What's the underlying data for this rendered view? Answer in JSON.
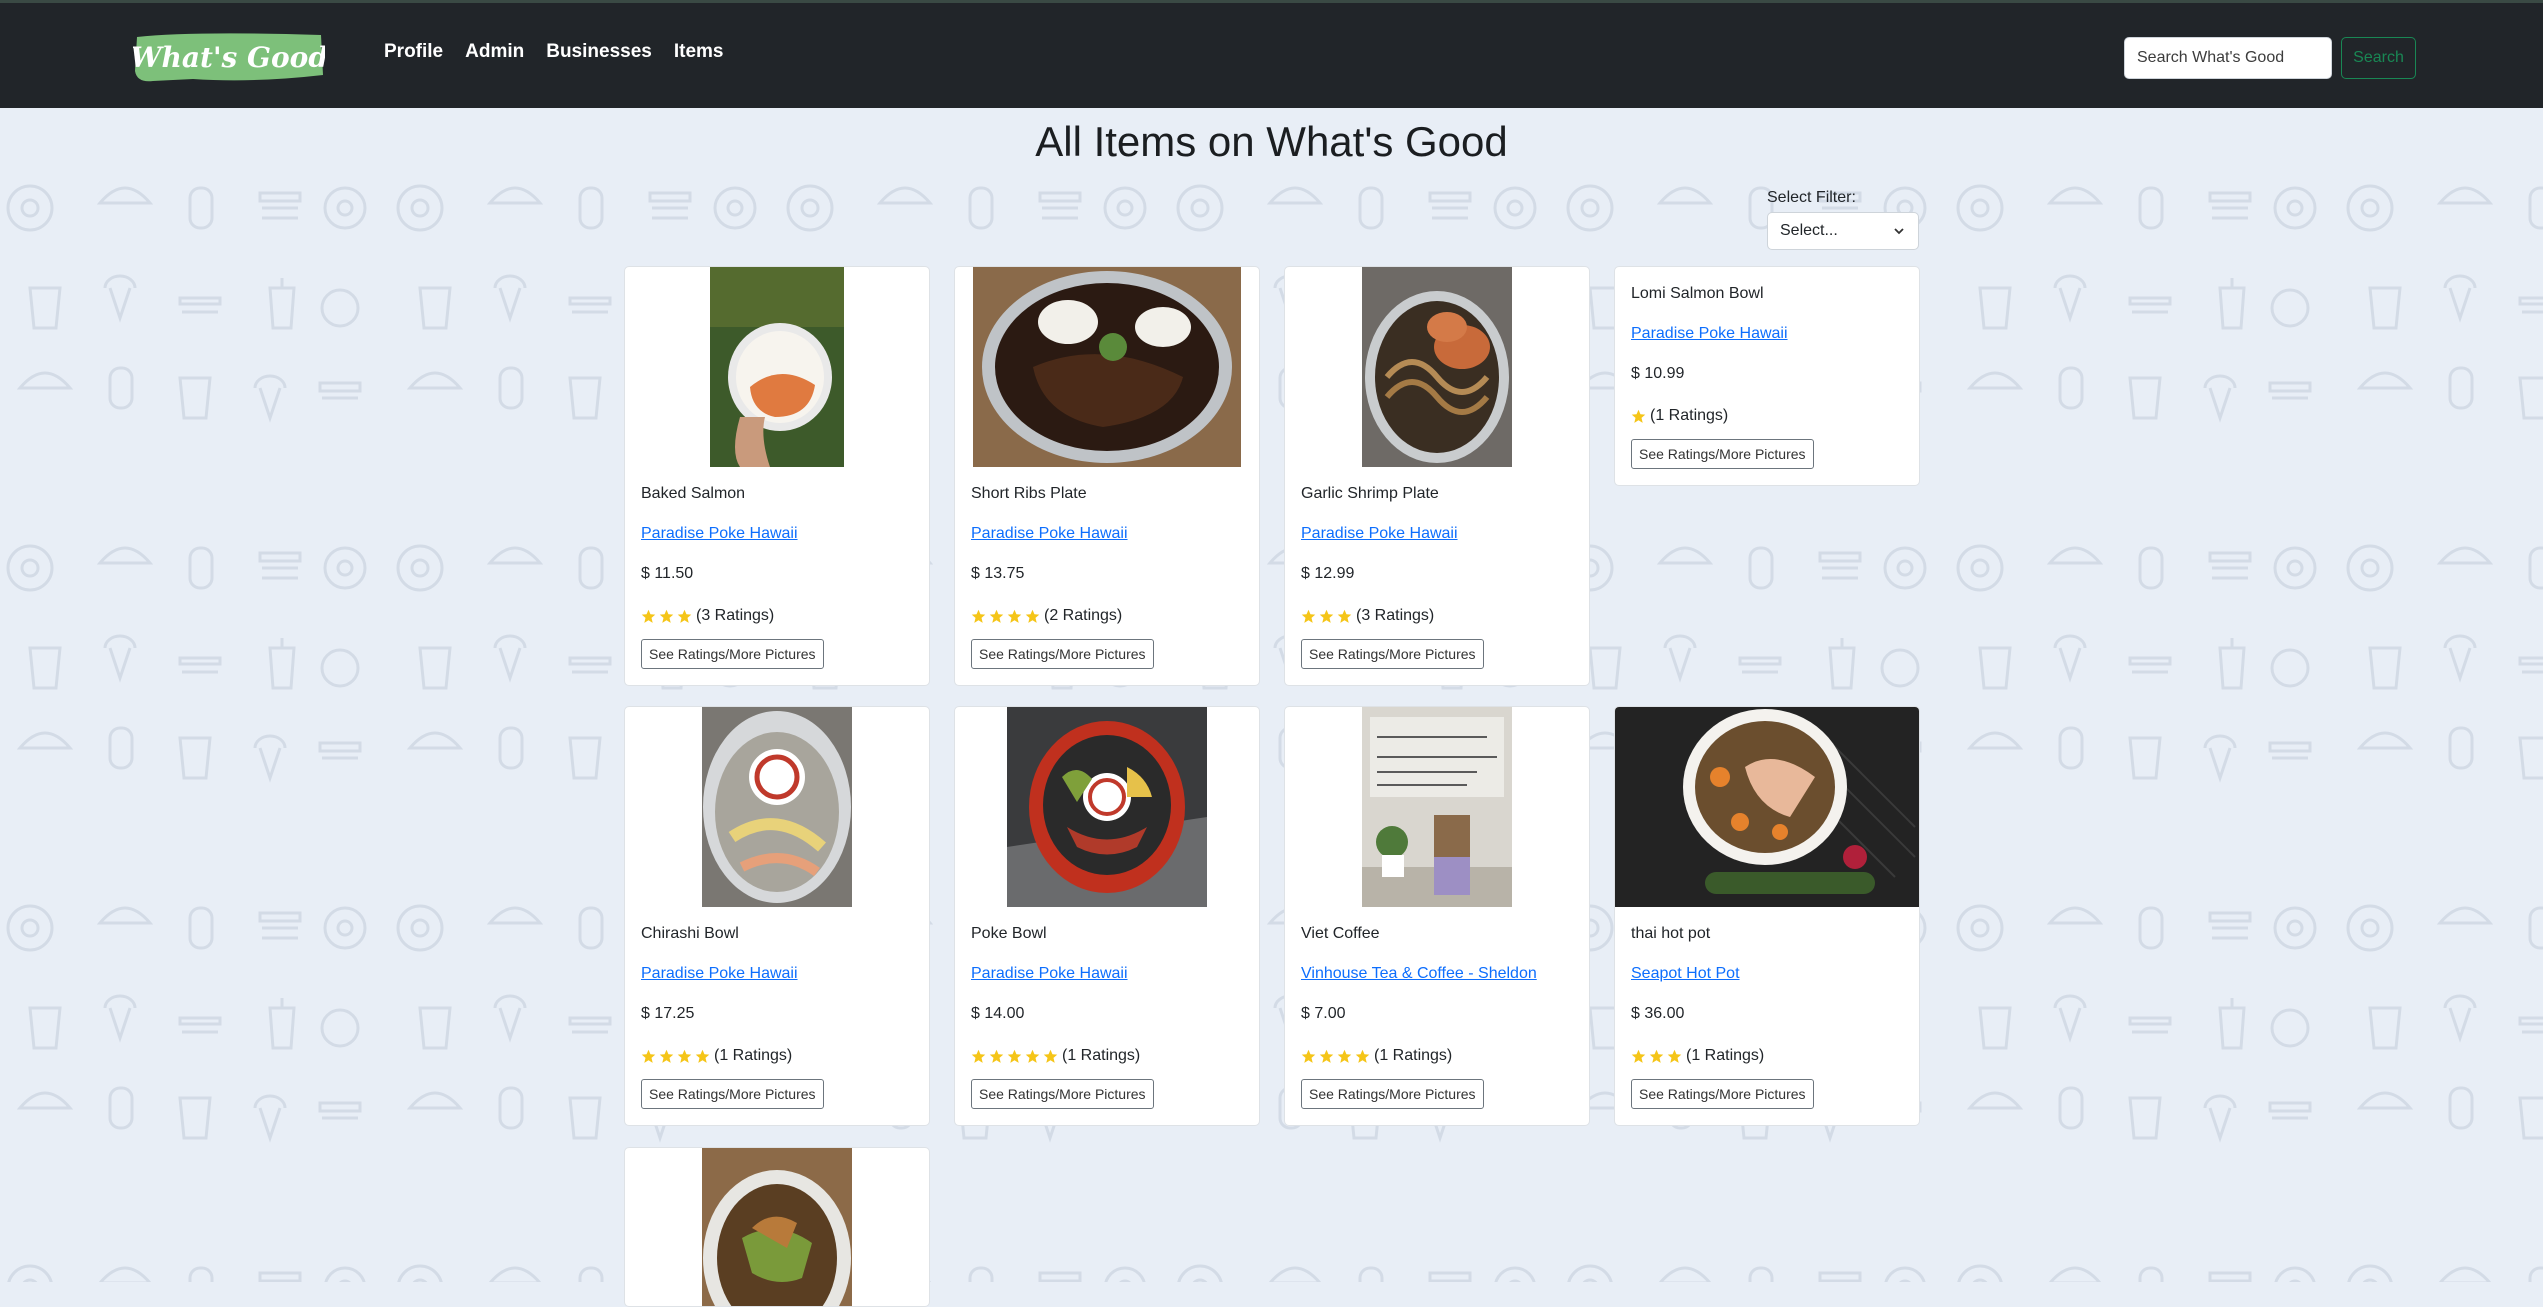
{
  "nav": {
    "logo_text": "What's Good",
    "links": [
      "Profile",
      "Admin",
      "Businesses",
      "Items"
    ],
    "search_placeholder": "Search What's Good",
    "search_button": "Search"
  },
  "page": {
    "title": "All Items on What's Good",
    "filter_label": "Select Filter:",
    "filter_value": "Select..."
  },
  "items": [
    {
      "name": "Baked Salmon",
      "business": "Paradise Poke Hawaii",
      "price": "$ 11.50",
      "stars": 3,
      "ratings": "(3 Ratings)",
      "button": "See Ratings/More Pictures",
      "image": "baked-salmon-photo"
    },
    {
      "name": "Short Ribs Plate",
      "business": "Paradise Poke Hawaii",
      "price": "$ 13.75",
      "stars": 4,
      "ratings": "(2 Ratings)",
      "button": "See Ratings/More Pictures",
      "image": "short-ribs-photo"
    },
    {
      "name": "Garlic Shrimp Plate",
      "business": "Paradise Poke Hawaii",
      "price": "$ 12.99",
      "stars": 3,
      "ratings": "(3 Ratings)",
      "button": "See Ratings/More Pictures",
      "image": "garlic-shrimp-photo"
    },
    {
      "name": "Lomi Salmon Bowl",
      "business": "Paradise Poke Hawaii",
      "price": "$ 10.99",
      "stars": 1,
      "ratings": "(1 Ratings)",
      "button": "See Ratings/More Pictures",
      "image": ""
    },
    {
      "name": "Chirashi Bowl",
      "business": "Paradise Poke Hawaii",
      "price": "$ 17.25",
      "stars": 4,
      "ratings": "(1 Ratings)",
      "button": "See Ratings/More Pictures",
      "image": "chirashi-bowl-photo"
    },
    {
      "name": "Poke Bowl",
      "business": "Paradise Poke Hawaii",
      "price": "$ 14.00",
      "stars": 5,
      "ratings": "(1 Ratings)",
      "button": "See Ratings/More Pictures",
      "image": "poke-bowl-photo"
    },
    {
      "name": "Viet Coffee",
      "business": "Vinhouse Tea & Coffee - Sheldon",
      "price": "$ 7.00",
      "stars": 4,
      "ratings": "(1 Ratings)",
      "button": "See Ratings/More Pictures",
      "image": "viet-coffee-photo"
    },
    {
      "name": "thai hot pot",
      "business": "Seapot Hot Pot",
      "price": "$ 36.00",
      "stars": 3,
      "ratings": "(1 Ratings)",
      "button": "See Ratings/More Pictures",
      "image": "thai-hot-pot-photo"
    }
  ],
  "colors": {
    "navbar": "#212529",
    "link": "#0d6efd",
    "star": "#f5c518",
    "logo_green": "#7dc07a",
    "search_green": "#198754"
  }
}
